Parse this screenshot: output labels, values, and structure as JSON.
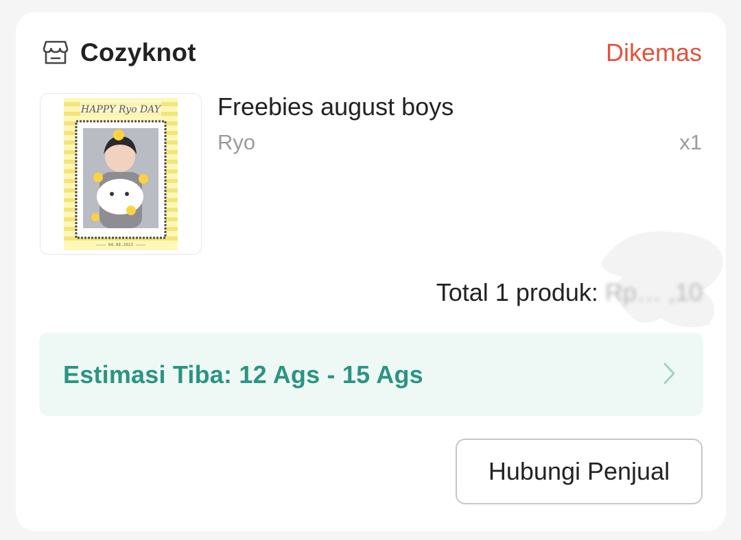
{
  "shop": {
    "icon": "store-icon",
    "name": "Cozyknot",
    "status": "Dikemas",
    "status_color": "#e0533a"
  },
  "product": {
    "title": "Freebies august boys",
    "variant": "Ryo",
    "quantity": "x1",
    "image_alt": "HAPPY Ryo DAY photocard"
  },
  "summary": {
    "total_label": "Total 1 produk: ",
    "total_value": "Rp… ,10"
  },
  "delivery": {
    "estimate": "Estimasi Tiba: 12 Ags - 15 Ags",
    "chevron_icon": "chevron-right-icon",
    "color": "#2b9482"
  },
  "actions": {
    "contact_seller": "Hubungi Penjual"
  }
}
